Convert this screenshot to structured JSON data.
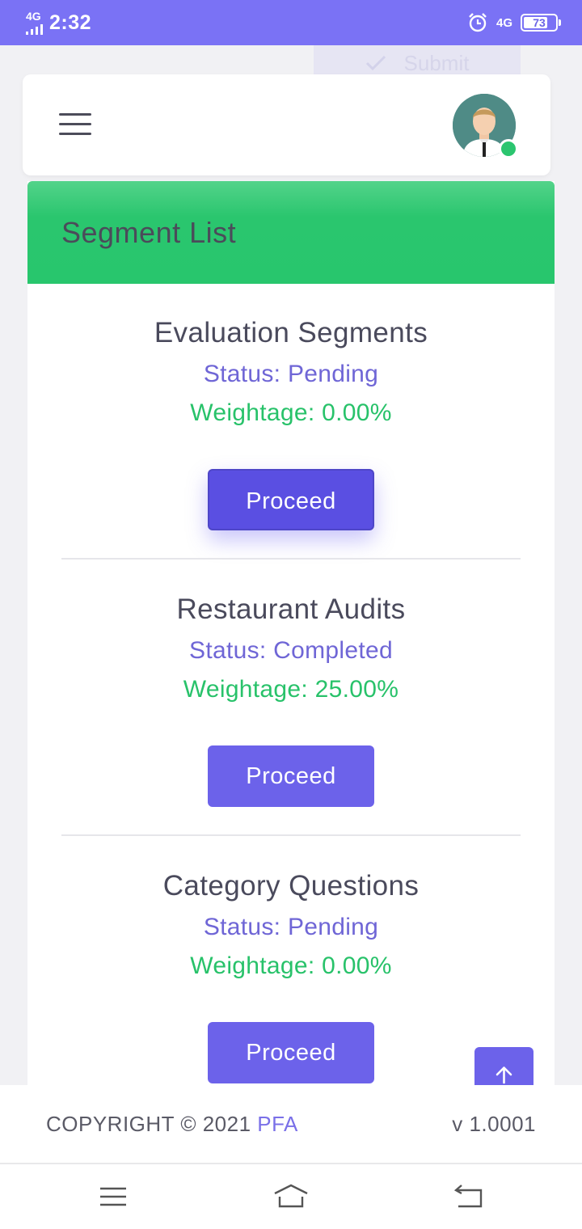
{
  "status_bar": {
    "network_small": "4G",
    "time": "2:32",
    "network_right": "4G",
    "battery": "73"
  },
  "ghost_button": {
    "label": "Submit"
  },
  "header": {},
  "card": {
    "title": "Segment List",
    "header_color": "#28c66d",
    "segments": [
      {
        "name": "Evaluation Segments",
        "status": "Status: Pending",
        "weightage": "Weightage: 0.00%",
        "action": "Proceed"
      },
      {
        "name": "Restaurant Audits",
        "status": "Status: Completed",
        "weightage": "Weightage: 25.00%",
        "action": "Proceed"
      },
      {
        "name": "Category Questions",
        "status": "Status: Pending",
        "weightage": "Weightage: 0.00%",
        "action": "Proceed"
      }
    ]
  },
  "footer": {
    "copyright": "COPYRIGHT © 2021 ",
    "brand": "PFA",
    "version": "v 1.0001"
  },
  "colors": {
    "primary": "#6c62ea",
    "success": "#28c66d",
    "status_bar": "#7a72f5"
  }
}
